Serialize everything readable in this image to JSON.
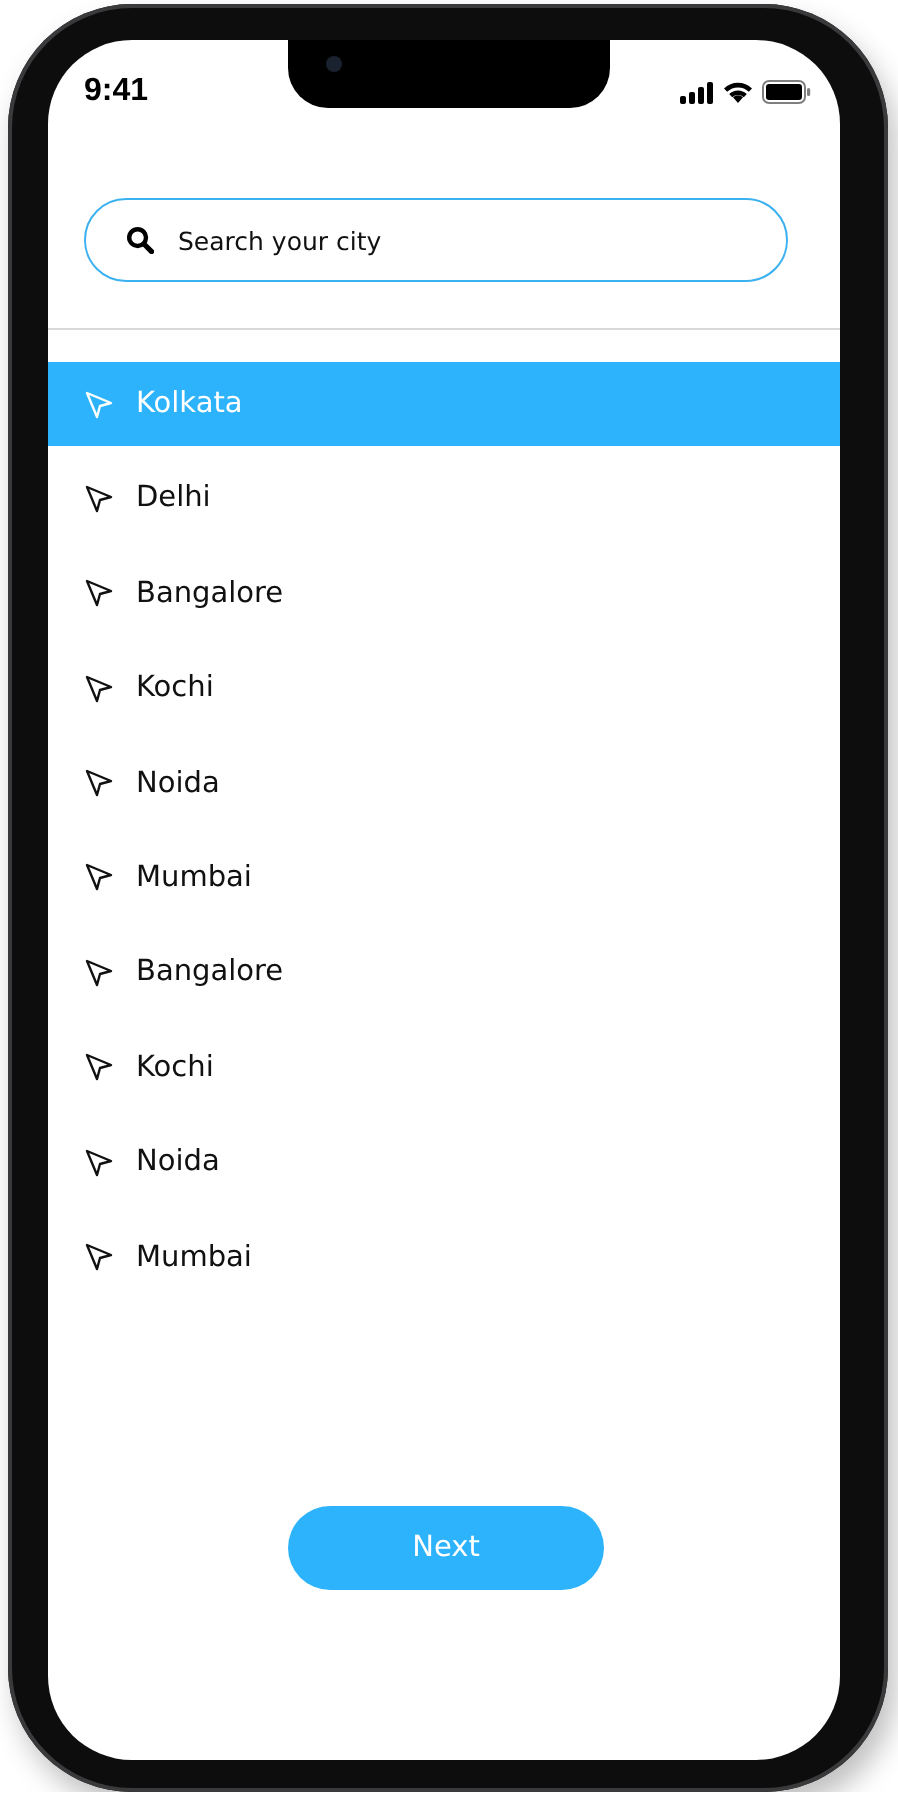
{
  "status_bar": {
    "time": "9:41"
  },
  "search": {
    "placeholder": "Search your city"
  },
  "cities": [
    {
      "name": "Kolkata",
      "selected": true
    },
    {
      "name": "Delhi",
      "selected": false
    },
    {
      "name": "Bangalore",
      "selected": false
    },
    {
      "name": "Kochi",
      "selected": false
    },
    {
      "name": "Noida",
      "selected": false
    },
    {
      "name": "Mumbai",
      "selected": false
    },
    {
      "name": "Bangalore",
      "selected": false
    },
    {
      "name": "Kochi",
      "selected": false
    },
    {
      "name": "Noida",
      "selected": false
    },
    {
      "name": "Mumbai",
      "selected": false
    }
  ],
  "next_button": {
    "label": "Next"
  }
}
